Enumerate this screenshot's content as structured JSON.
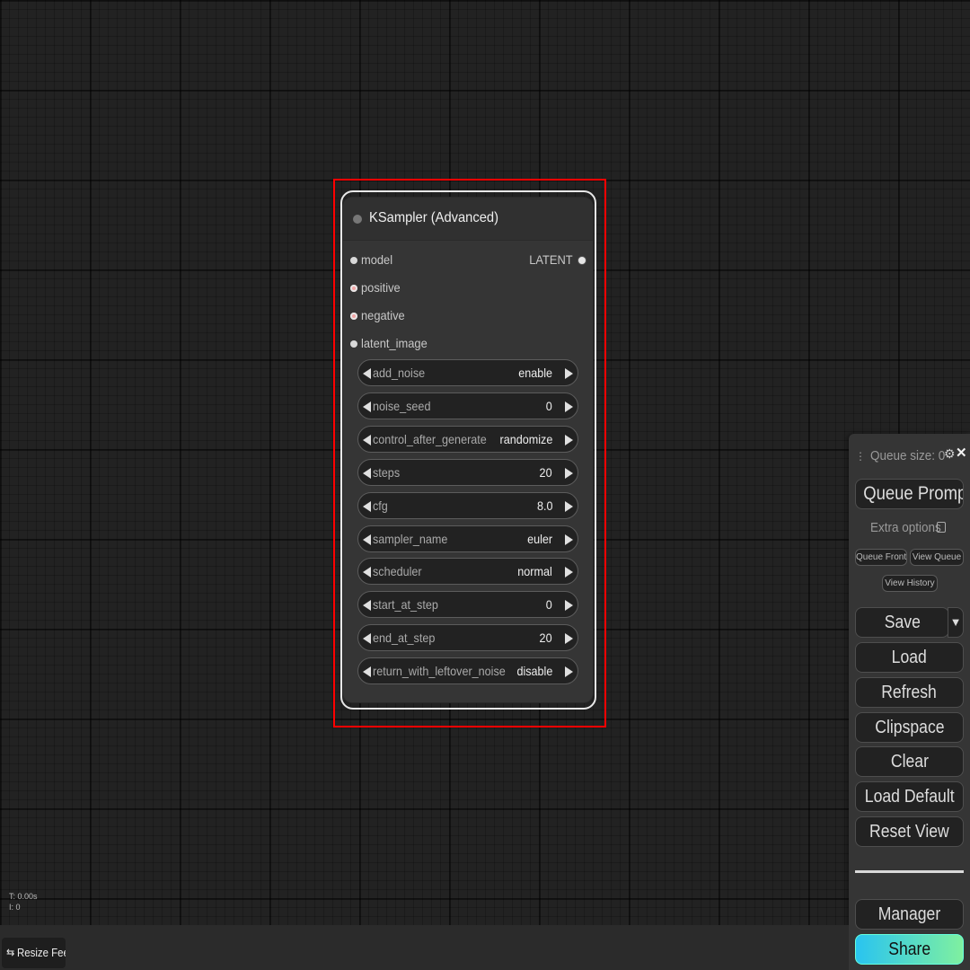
{
  "node": {
    "title": "KSampler (Advanced)",
    "inputs": [
      "model",
      "positive",
      "negative",
      "latent_image"
    ],
    "output": "LATENT",
    "widgets": [
      {
        "name": "add_noise",
        "value": "enable"
      },
      {
        "name": "noise_seed",
        "value": "0"
      },
      {
        "name": "control_after_generate",
        "value": "randomize"
      },
      {
        "name": "steps",
        "value": "20"
      },
      {
        "name": "cfg",
        "value": "8.0"
      },
      {
        "name": "sampler_name",
        "value": "euler"
      },
      {
        "name": "scheduler",
        "value": "normal"
      },
      {
        "name": "start_at_step",
        "value": "0"
      },
      {
        "name": "end_at_step",
        "value": "20"
      },
      {
        "name": "return_with_leftover_noise",
        "value": "disable"
      }
    ]
  },
  "menu": {
    "queue_size": "Queue size: 0",
    "queue_prompt": "Queue Prompt",
    "extra_options": "Extra options",
    "queue_front": "Queue Front",
    "view_queue": "View Queue",
    "view_history": "View History",
    "save": "Save",
    "save_dropdown": "▼",
    "load": "Load",
    "refresh": "Refresh",
    "clipspace": "Clipspace",
    "clear": "Clear",
    "load_default": "Load Default",
    "reset_view": "Reset View",
    "manager": "Manager",
    "share": "Share"
  },
  "stats": {
    "time": "T: 0.00s",
    "iterations": "I: 0"
  },
  "bottom": {
    "resize_feed": "Resize Feed"
  },
  "icons": {
    "gear": "gear-icon",
    "close": "close-icon",
    "drag": "drag-handle-icon",
    "resize": "resize-icon"
  }
}
